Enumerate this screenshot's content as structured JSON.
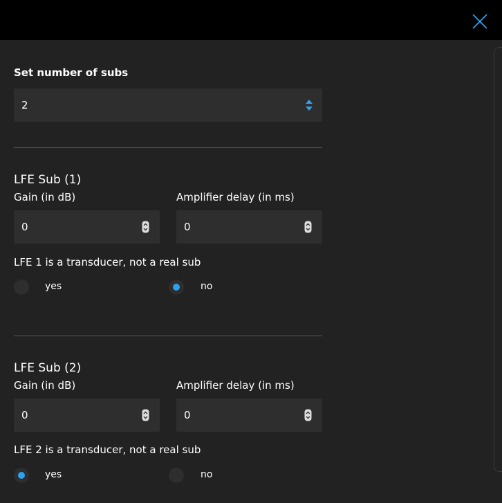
{
  "colors": {
    "background": "#222222",
    "topbar": "#000000",
    "input": "#2e2e2e",
    "accent": "#2ea1f0",
    "divider": "#5a5a5a"
  },
  "header": {
    "close_icon": "close-icon"
  },
  "subs_count": {
    "label": "Set number of subs",
    "value": "2"
  },
  "lfe_subs": [
    {
      "title": "LFE Sub (1)",
      "gain_label": "Gain (in dB)",
      "gain_value": "0",
      "delay_label": "Amplifier delay (in ms)",
      "delay_value": "0",
      "transducer_label": "LFE 1 is a transducer, not a real sub",
      "option_yes": "yes",
      "option_no": "no",
      "selected": "no"
    },
    {
      "title": "LFE Sub (2)",
      "gain_label": "Gain (in dB)",
      "gain_value": "0",
      "delay_label": "Amplifier delay (in ms)",
      "delay_value": "0",
      "transducer_label": "LFE 2 is a transducer, not a real sub",
      "option_yes": "yes",
      "option_no": "no",
      "selected": "yes"
    }
  ]
}
